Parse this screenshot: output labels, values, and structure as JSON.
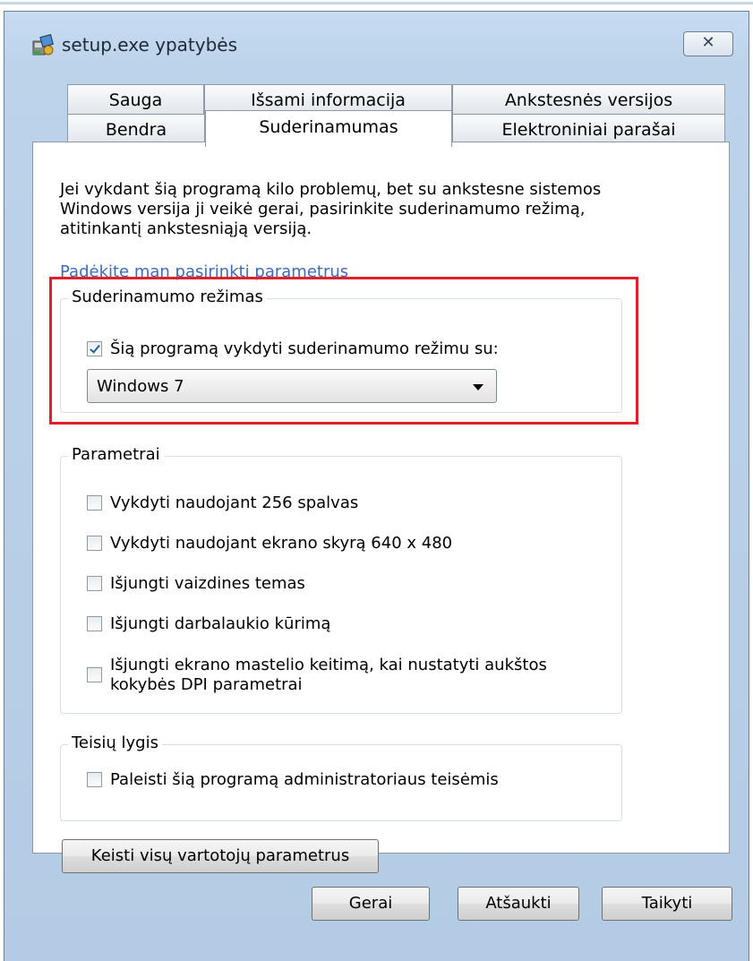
{
  "window": {
    "title": "setup.exe ypatybės",
    "close_label": "✕"
  },
  "tabs": {
    "row1": [
      "Sauga",
      "Išsami informacija",
      "Ankstesnės versijos"
    ],
    "row2": [
      "Bendra",
      "Suderinamumas",
      "Elektroniniai parašai"
    ],
    "active": "Suderinamumas"
  },
  "intro": {
    "lines": [
      "Jei vykdant šią programą kilo problemų, bet su ankstesne sistemos",
      "Windows versija ji veikė gerai, pasirinkite suderinamumo režimą,",
      "atitinkantį ankstesniąją versiją."
    ],
    "help_link": "Padėkite man pasirinkti parametrus"
  },
  "compat_mode": {
    "group_title": "Suderinamumo režimas",
    "checkbox_label": "Šią programą vykdyti suderinamumo režimu su:",
    "checked": true,
    "selected_os": "Windows 7"
  },
  "settings": {
    "group_title": "Parametrai",
    "options": [
      {
        "label": "Vykdyti naudojant 256 spalvas",
        "checked": false
      },
      {
        "label": "Vykdyti naudojant ekrano skyrą 640 x 480",
        "checked": false
      },
      {
        "label": "Išjungti vaizdines temas",
        "checked": false
      },
      {
        "label": "Išjungti darbalaukio kūrimą",
        "checked": false
      },
      {
        "label_line1": "Išjungti ekrano mastelio keitimą, kai nustatyti aukštos",
        "label_line2": "kokybės DPI parametrai",
        "checked": false
      }
    ]
  },
  "privilege": {
    "group_title": "Teisių lygis",
    "option_label": "Paleisti šią programą administratoriaus teisėmis",
    "checked": false
  },
  "buttons": {
    "change_all_users": "Keisti visų vartotojų parametrus",
    "ok": "Gerai",
    "cancel": "Atšaukti",
    "apply": "Taikyti"
  },
  "colors": {
    "highlight": "#e2202b",
    "link": "#3b6bbf"
  }
}
